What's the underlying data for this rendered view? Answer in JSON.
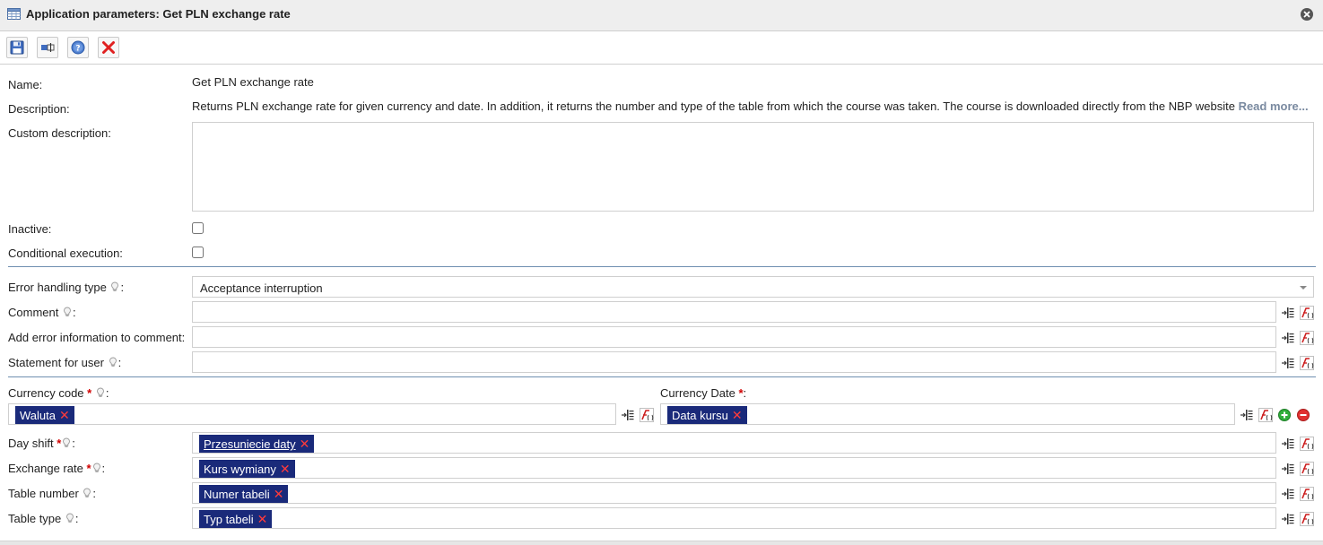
{
  "window": {
    "title": "Application parameters: Get PLN exchange rate",
    "icon": "table-icon",
    "close_icon": "close-circle-icon"
  },
  "toolbar": {
    "buttons": [
      {
        "name": "save",
        "icon": "save-icon"
      },
      {
        "name": "variables",
        "icon": "field-list-icon"
      },
      {
        "name": "help",
        "icon": "help-icon"
      },
      {
        "name": "delete",
        "icon": "red-x-icon"
      }
    ]
  },
  "form": {
    "name_label": "Name:",
    "name_value": "Get PLN exchange rate",
    "description_label": "Description:",
    "description_value": "Returns PLN exchange rate for given currency and date. In addition, it returns the number and type of the table from which the course was taken. The course is downloaded directly from the NBP website",
    "read_more": "Read more...",
    "custom_description_label": "Custom description:",
    "custom_description_value": "",
    "inactive_label": "Inactive:",
    "inactive_checked": false,
    "conditional_label": "Conditional execution:",
    "conditional_checked": false
  },
  "error_section": {
    "error_handling_label": "Error handling type",
    "error_handling_value": "Acceptance interruption",
    "comment_label": "Comment",
    "comment_value": "",
    "add_error_label": "Add error information to comment:",
    "add_error_value": "",
    "statement_label": "Statement for user",
    "statement_value": ""
  },
  "params": {
    "currency_code_label": "Currency code",
    "currency_code_tag": "Waluta",
    "currency_date_label": "Currency Date",
    "currency_date_tag": "Data kursu",
    "day_shift_label": "Day shift",
    "day_shift_tag": "Przesuniecie daty",
    "exchange_rate_label": "Exchange rate",
    "exchange_rate_tag": "Kurs wymiany",
    "table_number_label": "Table number",
    "table_number_tag": "Numer tabeli",
    "table_type_label": "Table type",
    "table_type_tag": "Typ tabeli"
  },
  "symbols": {
    "colon": ":",
    "required": "*",
    "tag_remove": "✕"
  },
  "colors": {
    "tag_bg": "#1a2a7a",
    "required": "#d00000",
    "divider": "#6f8fb0",
    "read_more": "#7a8aa0"
  }
}
